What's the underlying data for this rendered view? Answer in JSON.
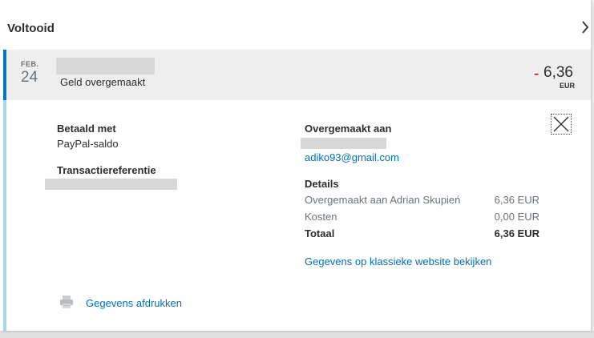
{
  "header": {
    "title": "Voltooid",
    "chevron_icon": "chevron-right-icon"
  },
  "summary": {
    "month": "FEB.",
    "day": "24",
    "description": "Geld overgemaakt",
    "amount_sign": "-",
    "amount": "6,36",
    "currency": "EUR",
    "accent_color": "#0079c1",
    "sign_color": "#d20000"
  },
  "left": {
    "paid_with_label": "Betaald met",
    "paid_with_value": "PayPal-saldo",
    "reference_label": "Transactiereferentie",
    "print_label": "Gegevens afdrukken",
    "print_icon": "printer-icon"
  },
  "right": {
    "transferred_to_label": "Overgemaakt aan",
    "email": "adiko93@gmail.com",
    "details_label": "Details",
    "rows": [
      {
        "label": "Overgemaakt aan Adrian Skupień",
        "value": "6,36 EUR"
      },
      {
        "label": "Kosten",
        "value": "0,00 EUR"
      },
      {
        "label": "Totaal",
        "value": "6,36 EUR"
      }
    ],
    "classic_link": "Gegevens op klassieke website bekijken"
  },
  "close_icon": "close-icon",
  "link_color": "#0070ba"
}
